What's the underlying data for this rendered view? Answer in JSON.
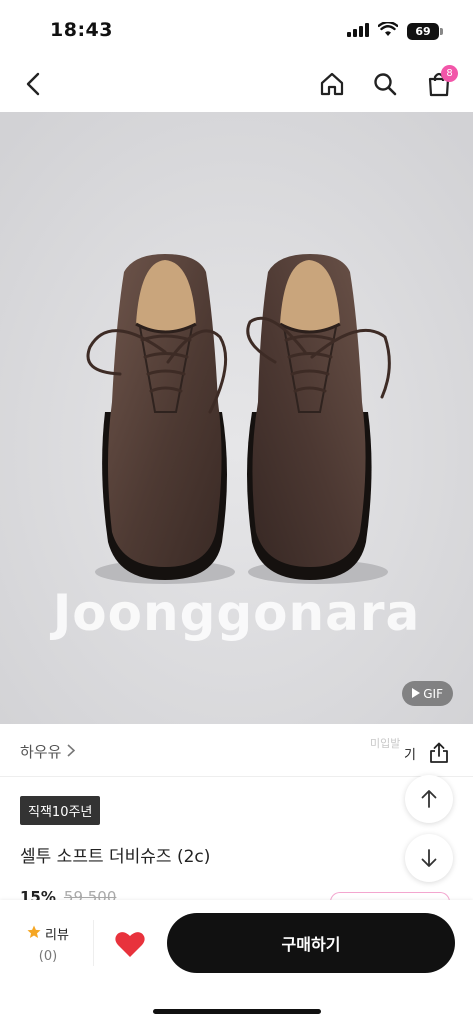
{
  "status_bar": {
    "time": "18:43",
    "battery": "69",
    "icons": [
      "signal-icon",
      "wifi-icon",
      "battery-icon"
    ]
  },
  "nav": {
    "icons": [
      "back-icon",
      "home-icon",
      "search-icon",
      "cart-icon"
    ],
    "cart_count": "8"
  },
  "product_image": {
    "watermark": "Joonggonara",
    "gif_label": "GIF"
  },
  "info": {
    "brand": "하우유",
    "faint_text": "미입발",
    "share_label": "기",
    "tag": "직잭10주년",
    "title": "셀투 소프트 더비슈즈 (2c)",
    "discount": "15%",
    "original_price": "59,500"
  },
  "bottom_bar": {
    "review_label": "리뷰",
    "review_count": "(0)",
    "buy_label": "구매하기"
  },
  "colors": {
    "accent_pink": "#f256a9",
    "like_red": "#e8323c",
    "star_orange": "#f5a623",
    "buy_button": "#111111"
  }
}
